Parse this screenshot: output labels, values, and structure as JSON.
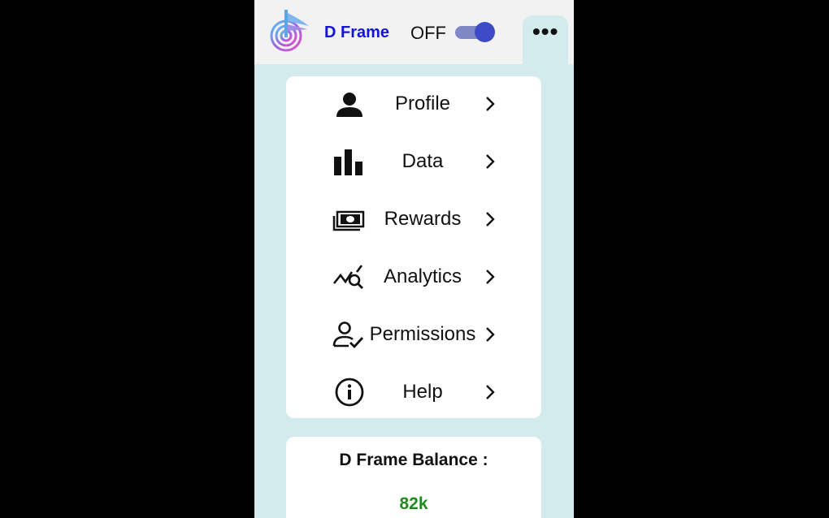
{
  "app": {
    "title": "D Frame",
    "power_state": "OFF",
    "more_label": "•••"
  },
  "menu": {
    "items": [
      {
        "label": "Profile",
        "icon": "person-icon"
      },
      {
        "label": "Data",
        "icon": "bar-chart-icon"
      },
      {
        "label": "Rewards",
        "icon": "money-icon"
      },
      {
        "label": "Analytics",
        "icon": "analytics-search-icon"
      },
      {
        "label": "Permissions",
        "icon": "user-check-icon"
      },
      {
        "label": "Help",
        "icon": "info-icon"
      }
    ]
  },
  "balance": {
    "title": "D Frame Balance :",
    "value": "82k"
  },
  "colors": {
    "brand": "#1414d6",
    "panel_bg": "#d3ebed",
    "toggle_knob": "#3d4cc6",
    "balance_value": "#1f8a1f"
  }
}
